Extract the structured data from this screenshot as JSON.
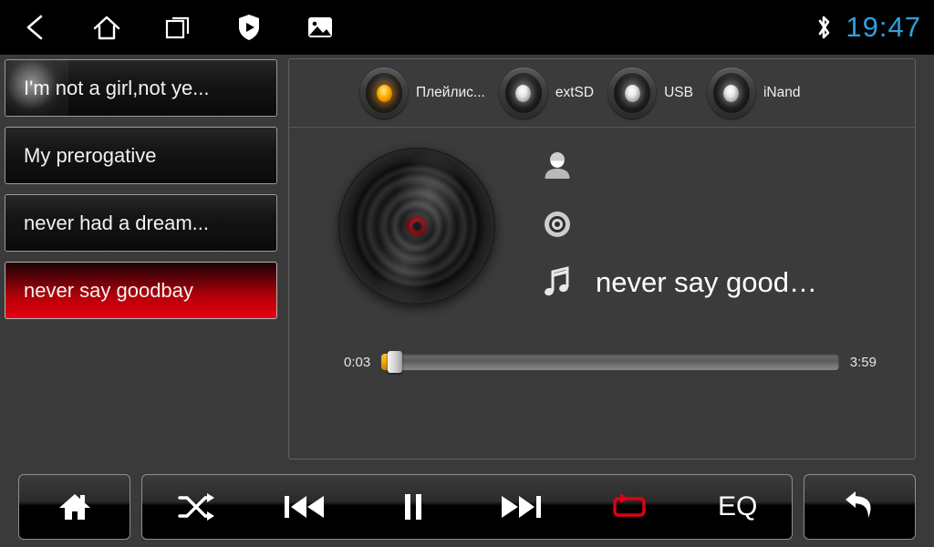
{
  "statusbar": {
    "icons": [
      {
        "name": "back-icon",
        "label": "Back"
      },
      {
        "name": "home-icon",
        "label": "Home"
      },
      {
        "name": "recents-icon",
        "label": "Recent apps"
      },
      {
        "name": "shield-play-icon",
        "label": "Shield"
      },
      {
        "name": "gallery-icon",
        "label": "Gallery"
      }
    ],
    "bluetooth_icon": "bluetooth-icon",
    "time": "19:47",
    "time_color": "#2e9fe0"
  },
  "playlist": {
    "items": [
      {
        "title": "I'm not a girl,not ye...",
        "selected": false,
        "pressed": true
      },
      {
        "title": "My prerogative",
        "selected": false,
        "pressed": false
      },
      {
        "title": "never had a dream...",
        "selected": false,
        "pressed": false
      },
      {
        "title": "never say goodbay",
        "selected": true,
        "pressed": false
      }
    ],
    "selected_color": "#e40010"
  },
  "sources": {
    "items": [
      {
        "label": "Плейлис...",
        "active": true
      },
      {
        "label": "extSD",
        "active": false
      },
      {
        "label": "USB",
        "active": false
      },
      {
        "label": "iNand",
        "active": false
      }
    ],
    "active_led_color": "#ffb300",
    "idle_led_color": "#e8e8e8"
  },
  "now_playing": {
    "artwork_icon": "vinyl-disc-icon",
    "artist_icon": "person-icon",
    "artist": "",
    "album_icon": "disc-icon",
    "album": "",
    "title_icon": "music-note-icon",
    "title": "never say good…",
    "elapsed": "0:03",
    "duration": "3:59",
    "progress_percent": 1.3,
    "progress_color": "#f0a808"
  },
  "bottom_bar": {
    "home_button": {
      "name": "home-button",
      "icon": "home-icon"
    },
    "transport": [
      {
        "name": "shuffle-button",
        "icon": "shuffle-icon",
        "label": "",
        "active": false
      },
      {
        "name": "previous-button",
        "icon": "previous-track-icon",
        "label": "",
        "active": false
      },
      {
        "name": "play-pause-button",
        "icon": "pause-icon",
        "label": "",
        "active": false
      },
      {
        "name": "next-button",
        "icon": "next-track-icon",
        "label": "",
        "active": false
      },
      {
        "name": "repeat-button",
        "icon": "repeat-icon",
        "label": "",
        "active": true
      },
      {
        "name": "equalizer-button",
        "icon": "",
        "label": "EQ",
        "active": false
      }
    ],
    "back_button": {
      "name": "back-button",
      "icon": "return-arrow-icon"
    },
    "active_icon_color": "#e00010"
  }
}
